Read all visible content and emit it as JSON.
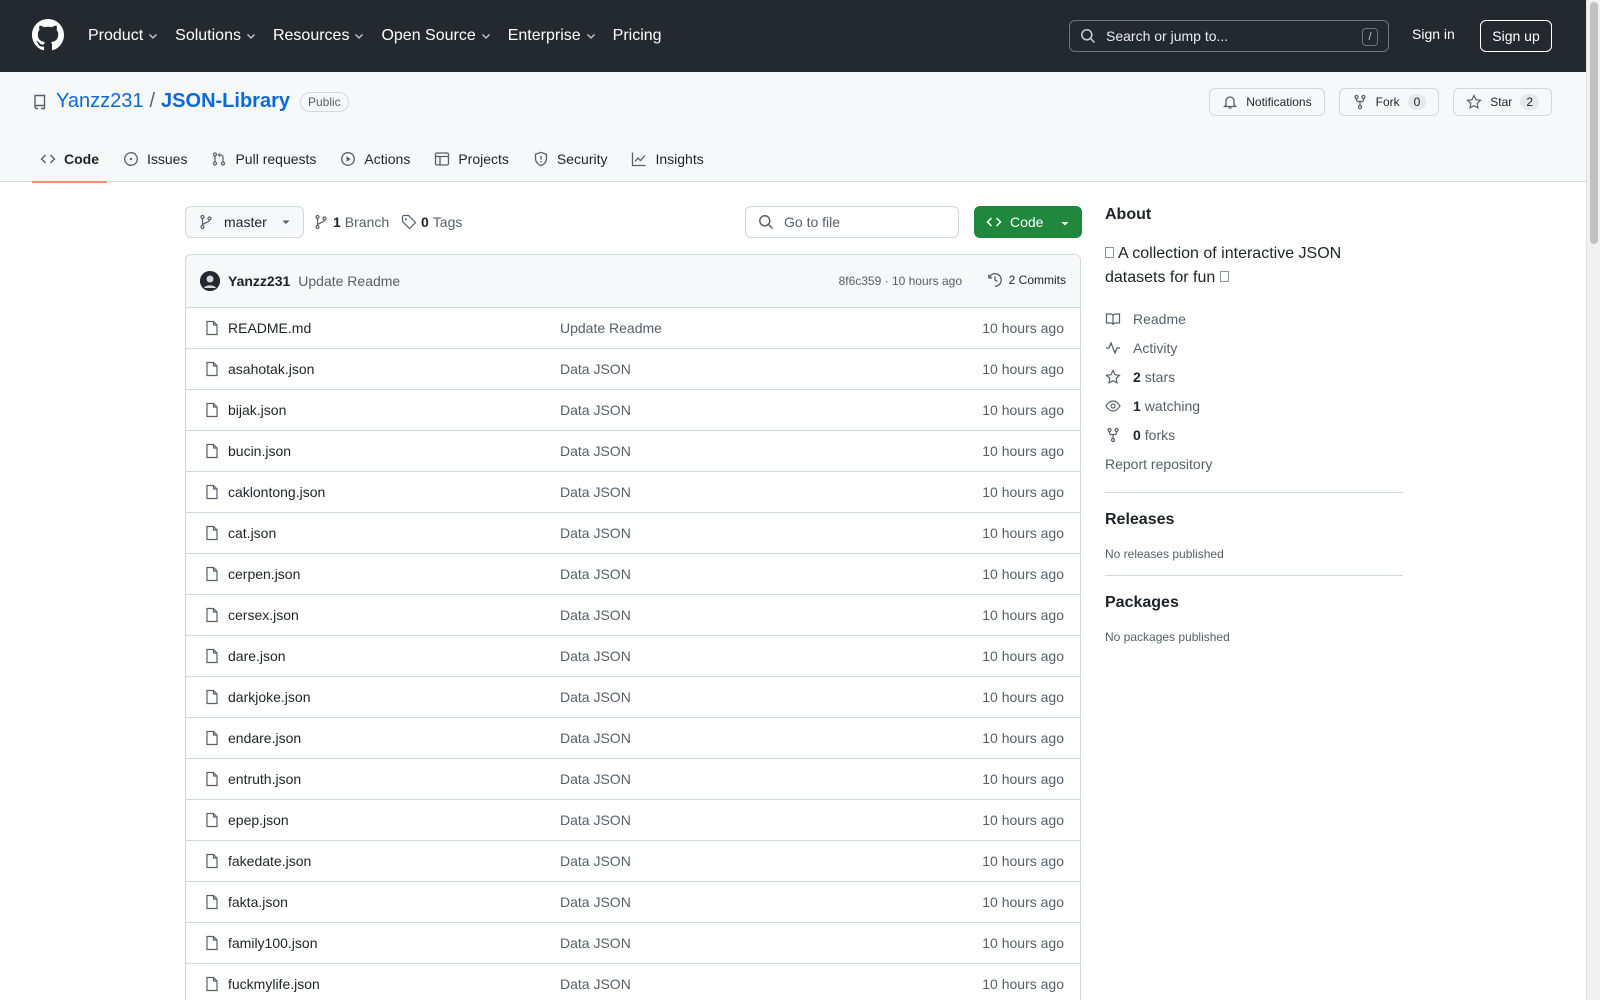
{
  "header": {
    "nav": [
      "Product",
      "Solutions",
      "Resources",
      "Open Source",
      "Enterprise",
      "Pricing"
    ],
    "search_placeholder": "Search or jump to...",
    "search_shortcut": "/",
    "sign_in": "Sign in",
    "sign_up": "Sign up"
  },
  "repo": {
    "owner": "Yanzz231",
    "separator": "/",
    "name": "JSON-Library",
    "visibility": "Public",
    "notifications_label": "Notifications",
    "fork_label": "Fork",
    "fork_count": "0",
    "star_label": "Star",
    "star_count": "2",
    "tabs": [
      "Code",
      "Issues",
      "Pull requests",
      "Actions",
      "Projects",
      "Security",
      "Insights"
    ]
  },
  "toolbar": {
    "branch": "master",
    "branch_count": "1",
    "branch_label": "Branch",
    "tag_count": "0",
    "tag_label": "Tags",
    "goto_placeholder": "Go to file",
    "code_label": "Code"
  },
  "commit": {
    "author": "Yanzz231",
    "message": "Update Readme",
    "meta": "8f6c359 · 10 hours ago",
    "commits": "2 Commits"
  },
  "files": [
    {
      "name": "README.md",
      "message": "Update Readme",
      "time": "10 hours ago"
    },
    {
      "name": "asahotak.json",
      "message": "Data JSON",
      "time": "10 hours ago"
    },
    {
      "name": "bijak.json",
      "message": "Data JSON",
      "time": "10 hours ago"
    },
    {
      "name": "bucin.json",
      "message": "Data JSON",
      "time": "10 hours ago"
    },
    {
      "name": "caklontong.json",
      "message": "Data JSON",
      "time": "10 hours ago"
    },
    {
      "name": "cat.json",
      "message": "Data JSON",
      "time": "10 hours ago"
    },
    {
      "name": "cerpen.json",
      "message": "Data JSON",
      "time": "10 hours ago"
    },
    {
      "name": "cersex.json",
      "message": "Data JSON",
      "time": "10 hours ago"
    },
    {
      "name": "dare.json",
      "message": "Data JSON",
      "time": "10 hours ago"
    },
    {
      "name": "darkjoke.json",
      "message": "Data JSON",
      "time": "10 hours ago"
    },
    {
      "name": "endare.json",
      "message": "Data JSON",
      "time": "10 hours ago"
    },
    {
      "name": "entruth.json",
      "message": "Data JSON",
      "time": "10 hours ago"
    },
    {
      "name": "epep.json",
      "message": "Data JSON",
      "time": "10 hours ago"
    },
    {
      "name": "fakedate.json",
      "message": "Data JSON",
      "time": "10 hours ago"
    },
    {
      "name": "fakta.json",
      "message": "Data JSON",
      "time": "10 hours ago"
    },
    {
      "name": "family100.json",
      "message": "Data JSON",
      "time": "10 hours ago"
    },
    {
      "name": "fuckmylife.json",
      "message": "Data JSON",
      "time": "10 hours ago"
    }
  ],
  "about": {
    "title": "About",
    "description": "A collection of interactive JSON datasets for fun",
    "readme": "Readme",
    "activity": "Activity",
    "stars_count": "2",
    "stars_label": "stars",
    "watching_count": "1",
    "watching_label": "watching",
    "forks_count": "0",
    "forks_label": "forks",
    "report": "Report repository"
  },
  "releases": {
    "title": "Releases",
    "empty": "No releases published"
  },
  "packages": {
    "title": "Packages",
    "empty": "No packages published"
  },
  "colors": {
    "header_bg": "#24292f",
    "link": "#0969da",
    "code_button": "#1f883d",
    "active_tab": "#fd8c73"
  }
}
